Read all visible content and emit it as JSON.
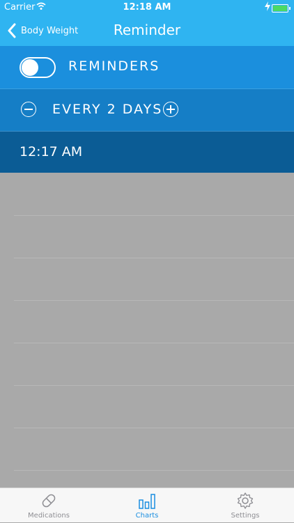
{
  "status": {
    "carrier": "Carrier",
    "time": "12:18 AM"
  },
  "nav": {
    "back_label": "Body Weight",
    "title": "Reminder"
  },
  "reminders": {
    "label": "REMINDERS",
    "enabled": false
  },
  "frequency": {
    "label": "EVERY 2 DAYS"
  },
  "time_row": {
    "time": "12:17 AM"
  },
  "tabs": [
    {
      "label": "Medications",
      "icon": "pill-icon",
      "active": false
    },
    {
      "label": "Charts",
      "icon": "bar-chart-icon",
      "active": true
    },
    {
      "label": "Settings",
      "icon": "gear-icon",
      "active": false
    }
  ],
  "colors": {
    "accent": "#2fb4f1",
    "active_tab": "#1a8ee0"
  }
}
